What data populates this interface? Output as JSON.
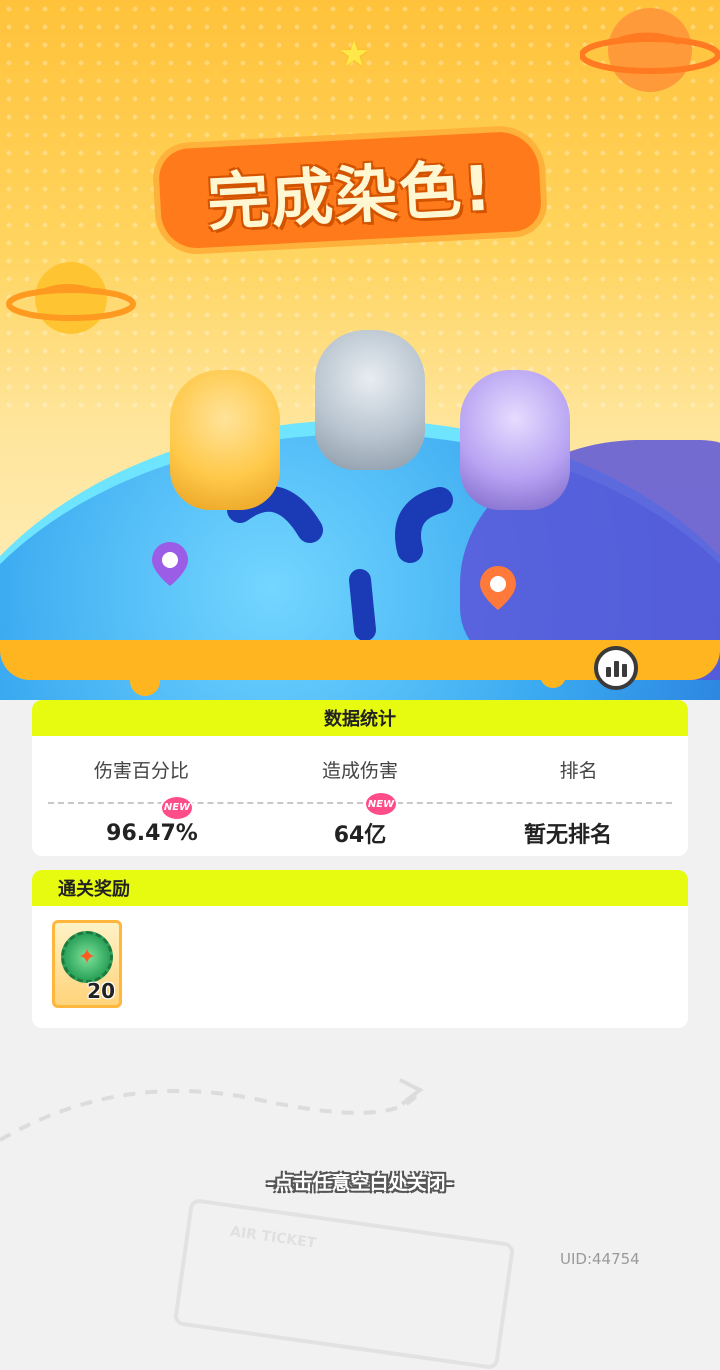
{
  "title": "完成染色!",
  "stats": {
    "header": "数据统计",
    "columns": [
      "伤害百分比",
      "造成伤害",
      "排名"
    ],
    "values": [
      "96.47%",
      "64亿",
      "暂无排名"
    ],
    "new_badge": "NEW"
  },
  "rewards": {
    "header": "通关奖励",
    "items": [
      {
        "icon": "bottle-cap-icon",
        "count": "20"
      }
    ]
  },
  "close_hint": "-点击任意空白处关闭-",
  "uid": "UID:44754",
  "ticket_text": "AIR TICKET",
  "colors": {
    "accent": "#e6fb0f",
    "title_orange": "#ff7a1a",
    "globe_blue": "#3aa9f0",
    "badge_pink": "#ff4d8a"
  }
}
